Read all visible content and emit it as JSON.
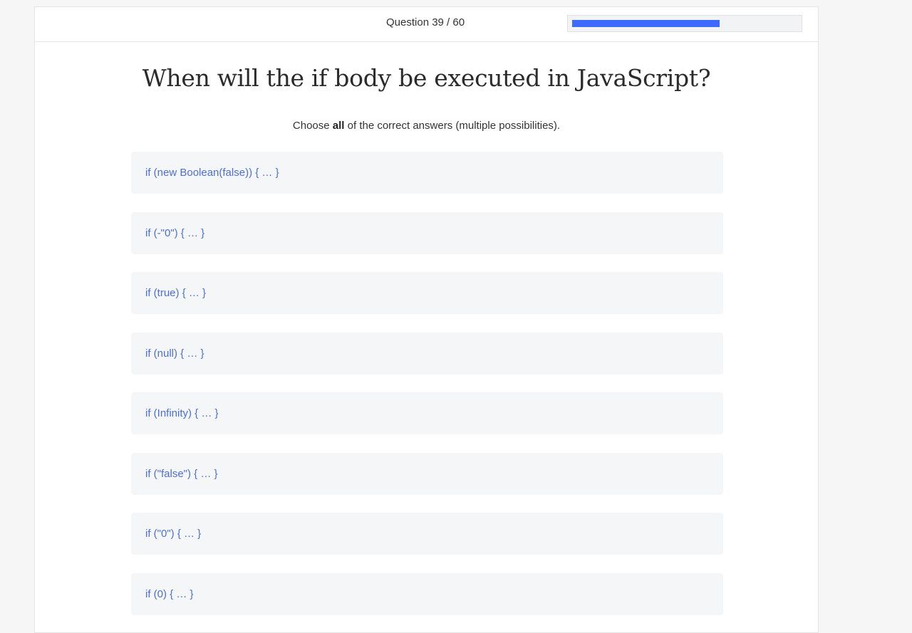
{
  "header": {
    "counter_prefix": "Question",
    "current": 39,
    "total": 60,
    "counter_text": "Question 39 / 60",
    "progress_fraction": 0.65,
    "progress_color": "#3d6bff"
  },
  "question": {
    "title": "When will the if body be executed in JavaScript?",
    "instruction_before": "Choose ",
    "instruction_bold": "all",
    "instruction_after": " of the correct answers (multiple possibilities)."
  },
  "options": [
    {
      "label": "if (new Boolean(false)) { … }"
    },
    {
      "label": "if (-\"0\") { … }"
    },
    {
      "label": "if (true) { … }"
    },
    {
      "label": "if (null) { … }"
    },
    {
      "label": "if (Infinity) { … }"
    },
    {
      "label": "if (\"false\") { … }"
    },
    {
      "label": "if (\"0\") { … }"
    },
    {
      "label": "if (0) { … }"
    }
  ],
  "colors": {
    "option_text": "#4b6fd9",
    "option_bg": "#f5f6f8",
    "page_bg": "#f6f6f7"
  }
}
